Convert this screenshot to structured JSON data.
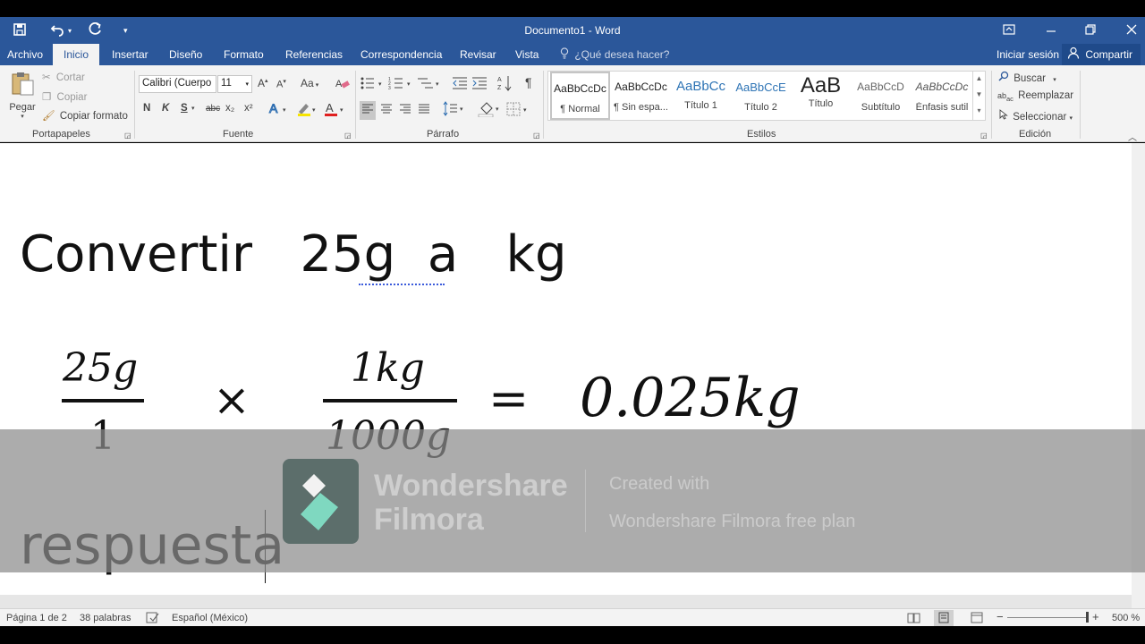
{
  "app": {
    "doc_title": "Documento1 - Word"
  },
  "tabs": {
    "archivo": "Archivo",
    "items": [
      "Inicio",
      "Insertar",
      "Diseño",
      "Formato",
      "Referencias",
      "Correspondencia",
      "Revisar",
      "Vista"
    ],
    "tell_me": "¿Qué desea hacer?",
    "sign_in": "Iniciar sesión",
    "share": "Compartir"
  },
  "ribbon": {
    "clipboard": {
      "paste": "Pegar",
      "cut": "Cortar",
      "copy": "Copiar",
      "format_painter": "Copiar formato",
      "label": "Portapapeles"
    },
    "font": {
      "font_name": "Calibri (Cuerpo",
      "font_size": "11",
      "change_case": "Aa",
      "bold": "N",
      "italic": "K",
      "underline": "S",
      "strike": "abc",
      "subscript": "x₂",
      "superscript": "x²",
      "label": "Fuente"
    },
    "paragraph": {
      "label": "Párrafo"
    },
    "styles": {
      "items": [
        {
          "preview": "AaBbCcDc",
          "name": "¶ Normal"
        },
        {
          "preview": "AaBbCcDc",
          "name": "¶ Sin espa..."
        },
        {
          "preview": "AaBbCc",
          "name": "Título 1"
        },
        {
          "preview": "AaBbCcE",
          "name": "Título 2"
        },
        {
          "preview": "AaB",
          "name": "Título"
        },
        {
          "preview": "AaBbCcD",
          "name": "Subtítulo"
        },
        {
          "preview": "AaBbCcDc",
          "name": "Énfasis sutil"
        }
      ],
      "label": "Estilos"
    },
    "editing": {
      "find": "Buscar",
      "replace": "Reemplazar",
      "select": "Seleccionar",
      "label": "Edición"
    }
  },
  "document": {
    "line1": "Convertir   25g  a   kg",
    "fraction1_num": "25g",
    "fraction1_den": "1",
    "times": "×",
    "fraction2_num": "1kg",
    "fraction2_den": "1000g",
    "equals": "=",
    "result": "0.025kg",
    "answer": "respuesta"
  },
  "watermark": {
    "brand_line1": "Wondershare",
    "brand_line2": "Filmora",
    "created_with": "Created with",
    "plan": "Wondershare Filmora free plan"
  },
  "status": {
    "page": "Página 1 de 2",
    "words": "38 palabras",
    "language": "Español (México)",
    "zoom": "500 %"
  },
  "colors": {
    "word_blue": "#2b579a",
    "ribbon_bg": "#f3f3f3"
  }
}
